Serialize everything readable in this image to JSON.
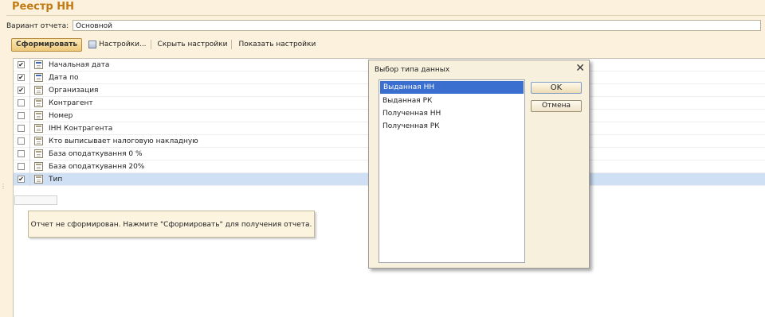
{
  "header": {
    "title": "Реестр НН"
  },
  "variant": {
    "label": "Вариант отчета:",
    "value": "Основной"
  },
  "toolbar": {
    "form_label": "Сформировать",
    "settings_label": "Настройки...",
    "hide_settings_label": "Скрыть настройки",
    "show_settings_label": "Показать настройки"
  },
  "params": [
    {
      "label": "Начальная дата",
      "checked": true,
      "icon": "calendar-icon"
    },
    {
      "label": "Дата по",
      "checked": true,
      "icon": "calendar-icon"
    },
    {
      "label": "Организация",
      "checked": true,
      "icon": "reference-icon"
    },
    {
      "label": "Контрагент",
      "checked": false,
      "icon": "reference-icon"
    },
    {
      "label": "Номер",
      "checked": false,
      "icon": "reference-icon"
    },
    {
      "label": "ІНН Контрагента",
      "checked": false,
      "icon": "reference-icon"
    },
    {
      "label": "Кто выписывает налоговую накладную",
      "checked": false,
      "icon": "reference-icon"
    },
    {
      "label": "База оподаткування 0 %",
      "checked": false,
      "icon": "reference-icon"
    },
    {
      "label": "База оподаткування 20%",
      "checked": false,
      "icon": "reference-icon"
    },
    {
      "label": "Тип",
      "checked": true,
      "icon": "reference-icon"
    }
  ],
  "message": "Отчет не сформирован. Нажмите \"Сформировать\" для получения отчета.",
  "dialog": {
    "title": "Выбор типа данных",
    "items": [
      "Выданная НН",
      "Выданная РК",
      "Полученная НН",
      "Полученная РК"
    ],
    "selected_index": 0,
    "ok_label": "OK",
    "cancel_label": "Отмена"
  },
  "colors": {
    "title": "#c27a14",
    "selection": "#3a6fcf",
    "row_selected": "#cfe0f5"
  }
}
